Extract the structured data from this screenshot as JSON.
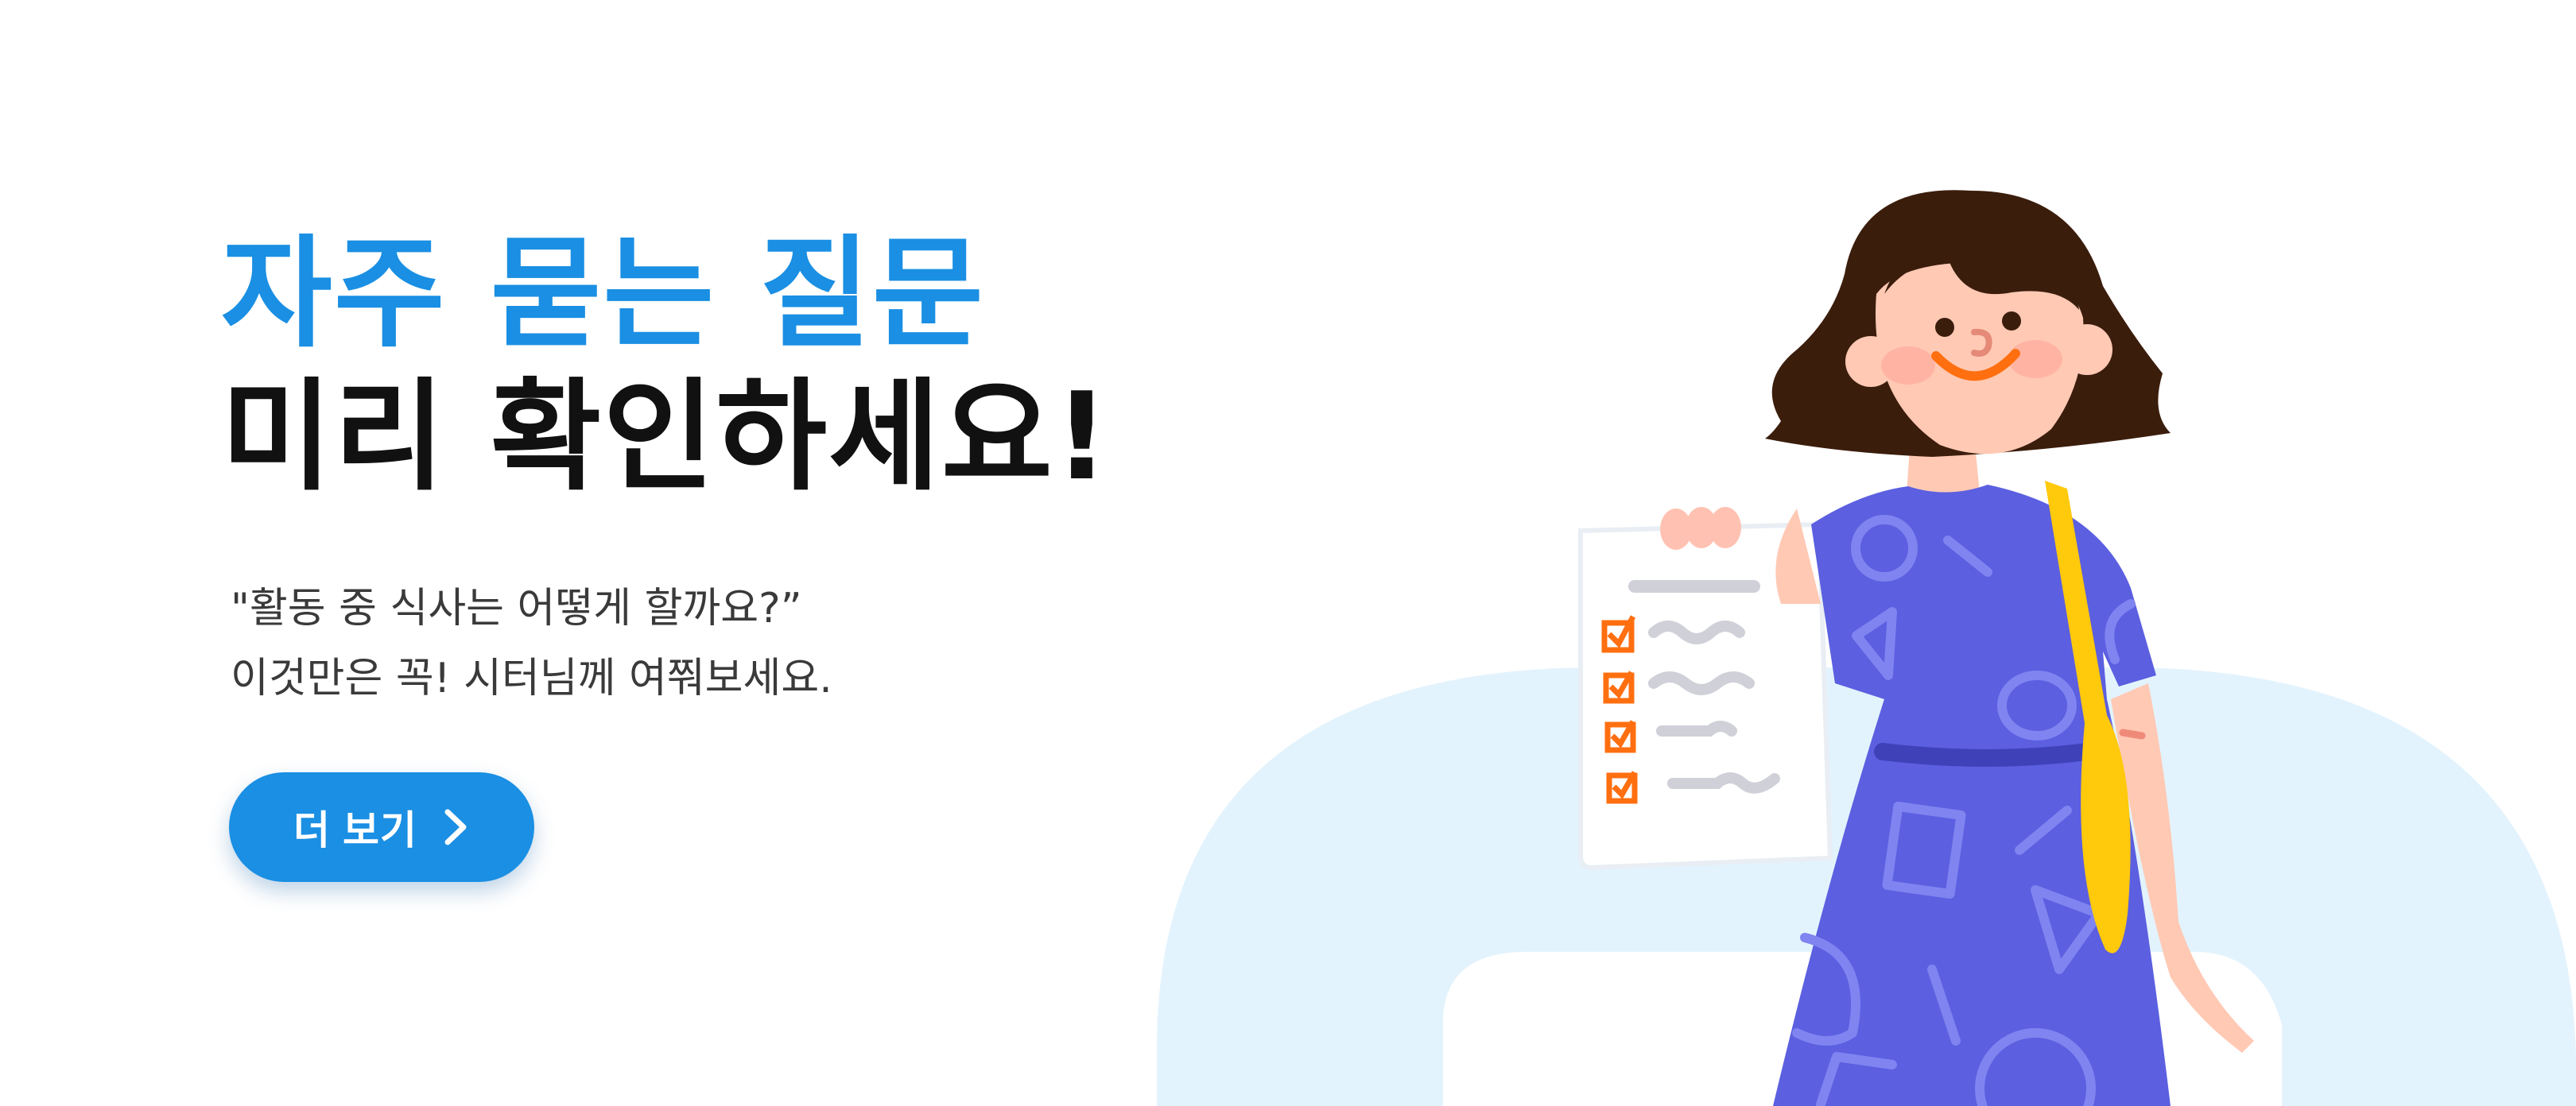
{
  "hero": {
    "title_line1": "자주 묻는 질문",
    "title_line2": "미리 확인하세요!",
    "desc_line1": "\"활동 중 식사는 어떻게 할까요?”",
    "desc_line2": "이것만은 꼭! 시터님께 여쭤보세요.",
    "button_label": "더 보기",
    "button_icon": "chevron-right-icon"
  },
  "colors": {
    "accent": "#1a8fe3",
    "title_dark": "#111111",
    "body_text": "#3a3a3a",
    "background_shape": "#e3f3fd",
    "dress": "#5b5fe0",
    "bag": "#ffc90c",
    "hair": "#3b1d0c",
    "checkmark": "#ff6f10"
  }
}
